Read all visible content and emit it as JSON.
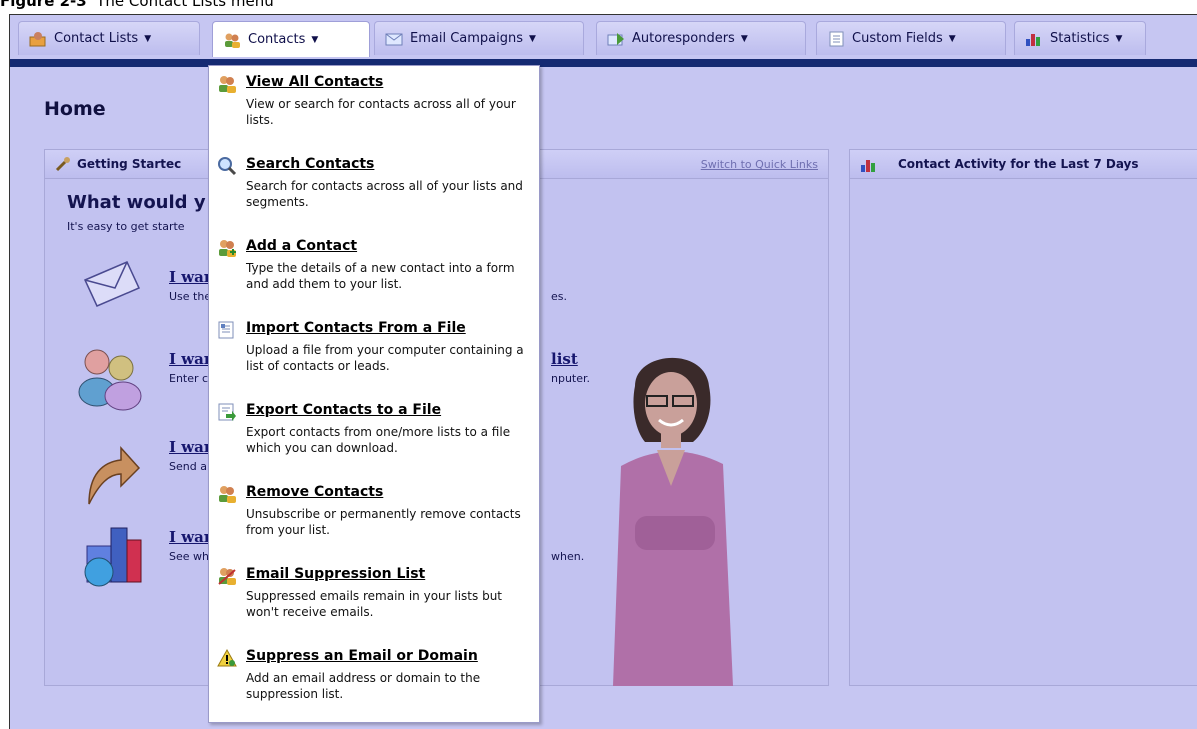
{
  "caption": {
    "figure": "Figure 2-3",
    "title": "The Contact Lists menu"
  },
  "tabs": [
    {
      "label": "Contact Lists",
      "icon": "contact-lists-icon"
    },
    {
      "label": "Contacts",
      "icon": "contacts-icon",
      "active": true
    },
    {
      "label": "Email Campaigns",
      "icon": "email-campaigns-icon"
    },
    {
      "label": "Autoresponders",
      "icon": "autoresponders-icon"
    },
    {
      "label": "Custom Fields",
      "icon": "custom-fields-icon"
    },
    {
      "label": "Statistics",
      "icon": "statistics-icon"
    }
  ],
  "page": {
    "title": "Home"
  },
  "getting_started": {
    "header": "Getting Startec",
    "switch_link": "Switch to Quick Links",
    "heading": "What would y",
    "intro": "It's easy to get starte",
    "tasks": [
      {
        "title": "I war",
        "desc": "Use the",
        "tail": "es."
      },
      {
        "title": "I war",
        "desc": "Enter c",
        "tail": "nputer.",
        "tail_link": "list"
      },
      {
        "title": "I war",
        "desc": "Send ai",
        "tail": ""
      },
      {
        "title": "I war",
        "desc": "See wh",
        "tail": "when."
      }
    ]
  },
  "activity": {
    "header": "Contact Activity for the Last 7 Days"
  },
  "contacts_menu": [
    {
      "title": "View All Contacts",
      "desc": "View or search for contacts across all of your lists.",
      "icon": "contacts-icon"
    },
    {
      "title": "Search Contacts",
      "desc": "Search for contacts across all of your lists and segments.",
      "icon": "search-icon"
    },
    {
      "title": "Add a Contact",
      "desc": "Type the details of a new contact into a form and add them to your list.",
      "icon": "add-contact-icon"
    },
    {
      "title": "Import Contacts From a File",
      "desc": "Upload a file from your computer containing a list of contacts or leads.",
      "icon": "import-file-icon"
    },
    {
      "title": "Export Contacts to a File",
      "desc": "Export contacts from one/more lists to a file which you can download.",
      "icon": "export-file-icon"
    },
    {
      "title": "Remove Contacts",
      "desc": "Unsubscribe or permanently remove contacts from your list.",
      "icon": "remove-contacts-icon"
    },
    {
      "title": "Email Suppression List",
      "desc": "Suppressed emails remain in your lists but won't receive emails.",
      "icon": "suppression-list-icon"
    },
    {
      "title": "Suppress an Email or Domain",
      "desc": "Add an email address or domain to the suppression list.",
      "icon": "warning-icon"
    }
  ]
}
